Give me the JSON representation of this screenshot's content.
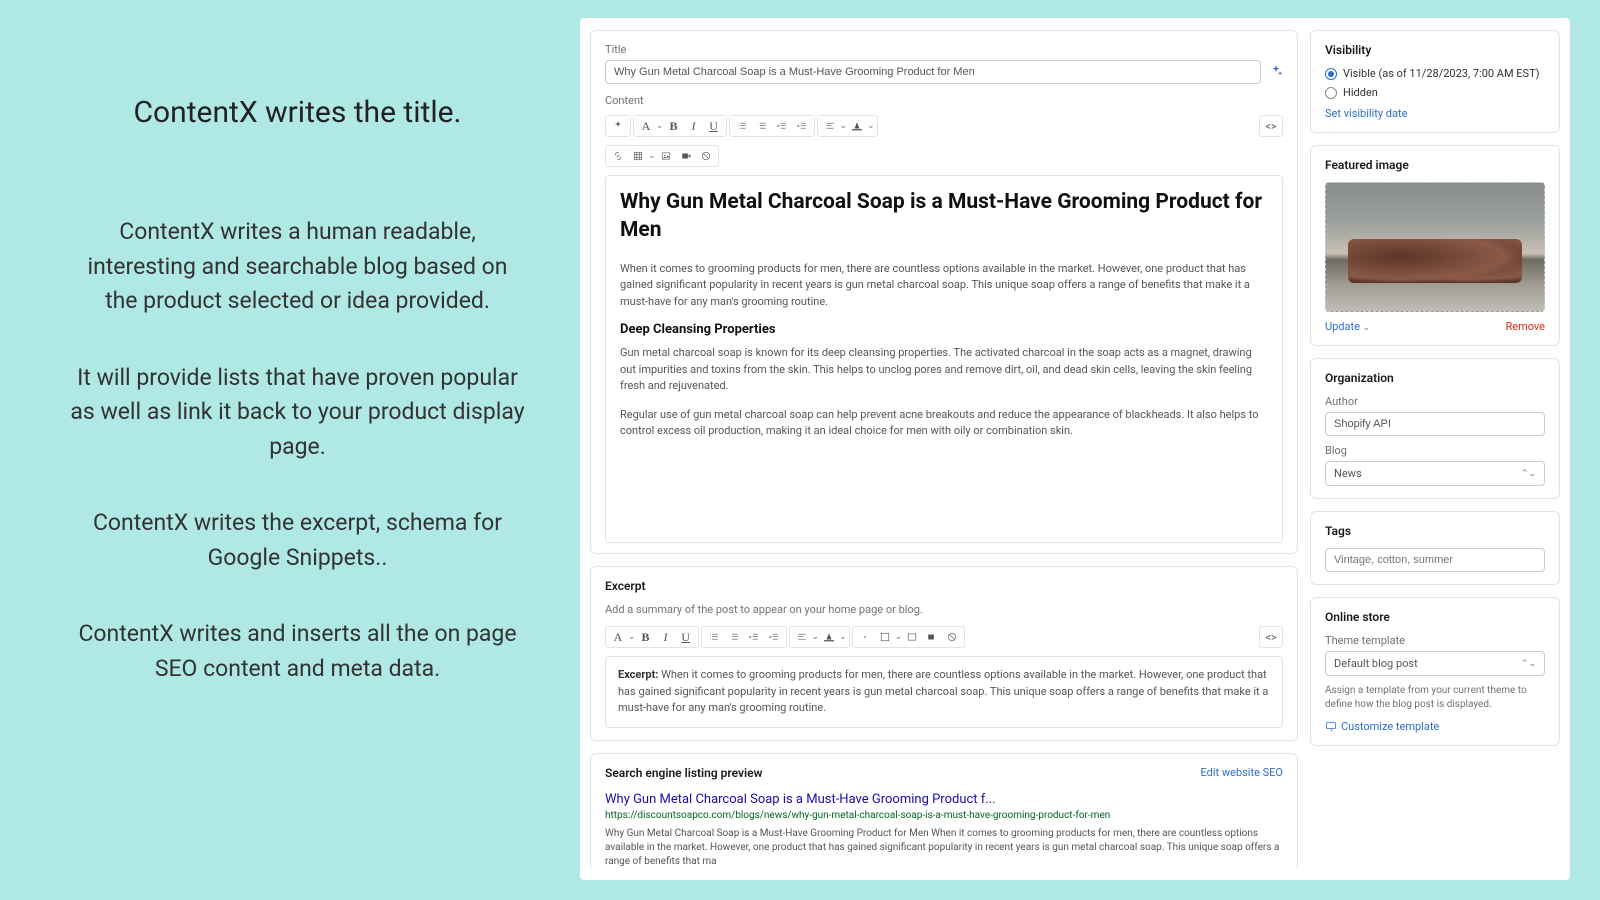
{
  "left": {
    "heading": "ContentX writes the title.",
    "p1": "ContentX writes a human readable, interesting and searchable blog based on the product selected or idea provided.",
    "p2": "It will provide lists that have proven popular as well as link it back to your product display page.",
    "p3": "ContentX writes the excerpt, schema for Google Snippets..",
    "p4": "ContentX writes and inserts all the on page SEO content and meta data."
  },
  "title_section": {
    "label": "Title",
    "value": "Why Gun Metal Charcoal Soap is a Must-Have Grooming Product for Men"
  },
  "content_section": {
    "label": "Content",
    "heading": "Why Gun Metal Charcoal Soap is a Must-Have Grooming Product for Men",
    "p1": "When it comes to grooming products for men, there are countless options available in the market. However, one product that has gained significant popularity in recent years is gun metal charcoal soap. This unique soap offers a range of benefits that make it a must-have for any man's grooming routine.",
    "h3": "Deep Cleansing Properties",
    "p2": "Gun metal charcoal soap is known for its deep cleansing properties. The activated charcoal in the soap acts as a magnet, drawing out impurities and toxins from the skin. This helps to unclog pores and remove dirt, oil, and dead skin cells, leaving the skin feeling fresh and rejuvenated.",
    "p3": "Regular use of gun metal charcoal soap can help prevent acne breakouts and reduce the appearance of blackheads. It also helps to control excess oil production, making it an ideal choice for men with oily or combination skin."
  },
  "excerpt_section": {
    "title": "Excerpt",
    "help": "Add a summary of the post to appear on your home page or blog.",
    "prefix": "Excerpt:",
    "body": " When it comes to grooming products for men, there are countless options available in the market. However, one product that has gained significant popularity in recent years is gun metal charcoal soap. This unique soap offers a range of benefits that make it a must-have for any man's grooming routine."
  },
  "seo_section": {
    "title": "Search engine listing preview",
    "edit": "Edit website SEO",
    "page_title": "Why Gun Metal Charcoal Soap is a Must-Have Grooming Product f...",
    "url": "https://discountsoapco.com/blogs/news/why-gun-metal-charcoal-soap-is-a-must-have-grooming-product-for-men",
    "desc": "Why Gun Metal Charcoal Soap is a Must-Have Grooming Product for Men When it comes to grooming products for men, there are countless options available in the market. However, one product that has gained significant popularity in recent years is gun metal charcoal soap. This unique soap offers a range of benefits that ma"
  },
  "visibility": {
    "title": "Visibility",
    "visible": "Visible (as of 11/28/2023, 7:00 AM EST)",
    "hidden": "Hidden",
    "set_date": "Set visibility date"
  },
  "featured": {
    "title": "Featured image",
    "update": "Update",
    "remove": "Remove"
  },
  "organization": {
    "title": "Organization",
    "author_label": "Author",
    "author_value": "Shopify API",
    "blog_label": "Blog",
    "blog_value": "News"
  },
  "tags": {
    "title": "Tags",
    "placeholder": "Vintage, cotton, summer"
  },
  "online_store": {
    "title": "Online store",
    "template_label": "Theme template",
    "template_value": "Default blog post",
    "note": "Assign a template from your current theme to define how the blog post is displayed.",
    "customize": "Customize template"
  },
  "icons": {
    "bold": "B",
    "italic": "I",
    "underline": "U",
    "font": "A",
    "code": "<>"
  }
}
